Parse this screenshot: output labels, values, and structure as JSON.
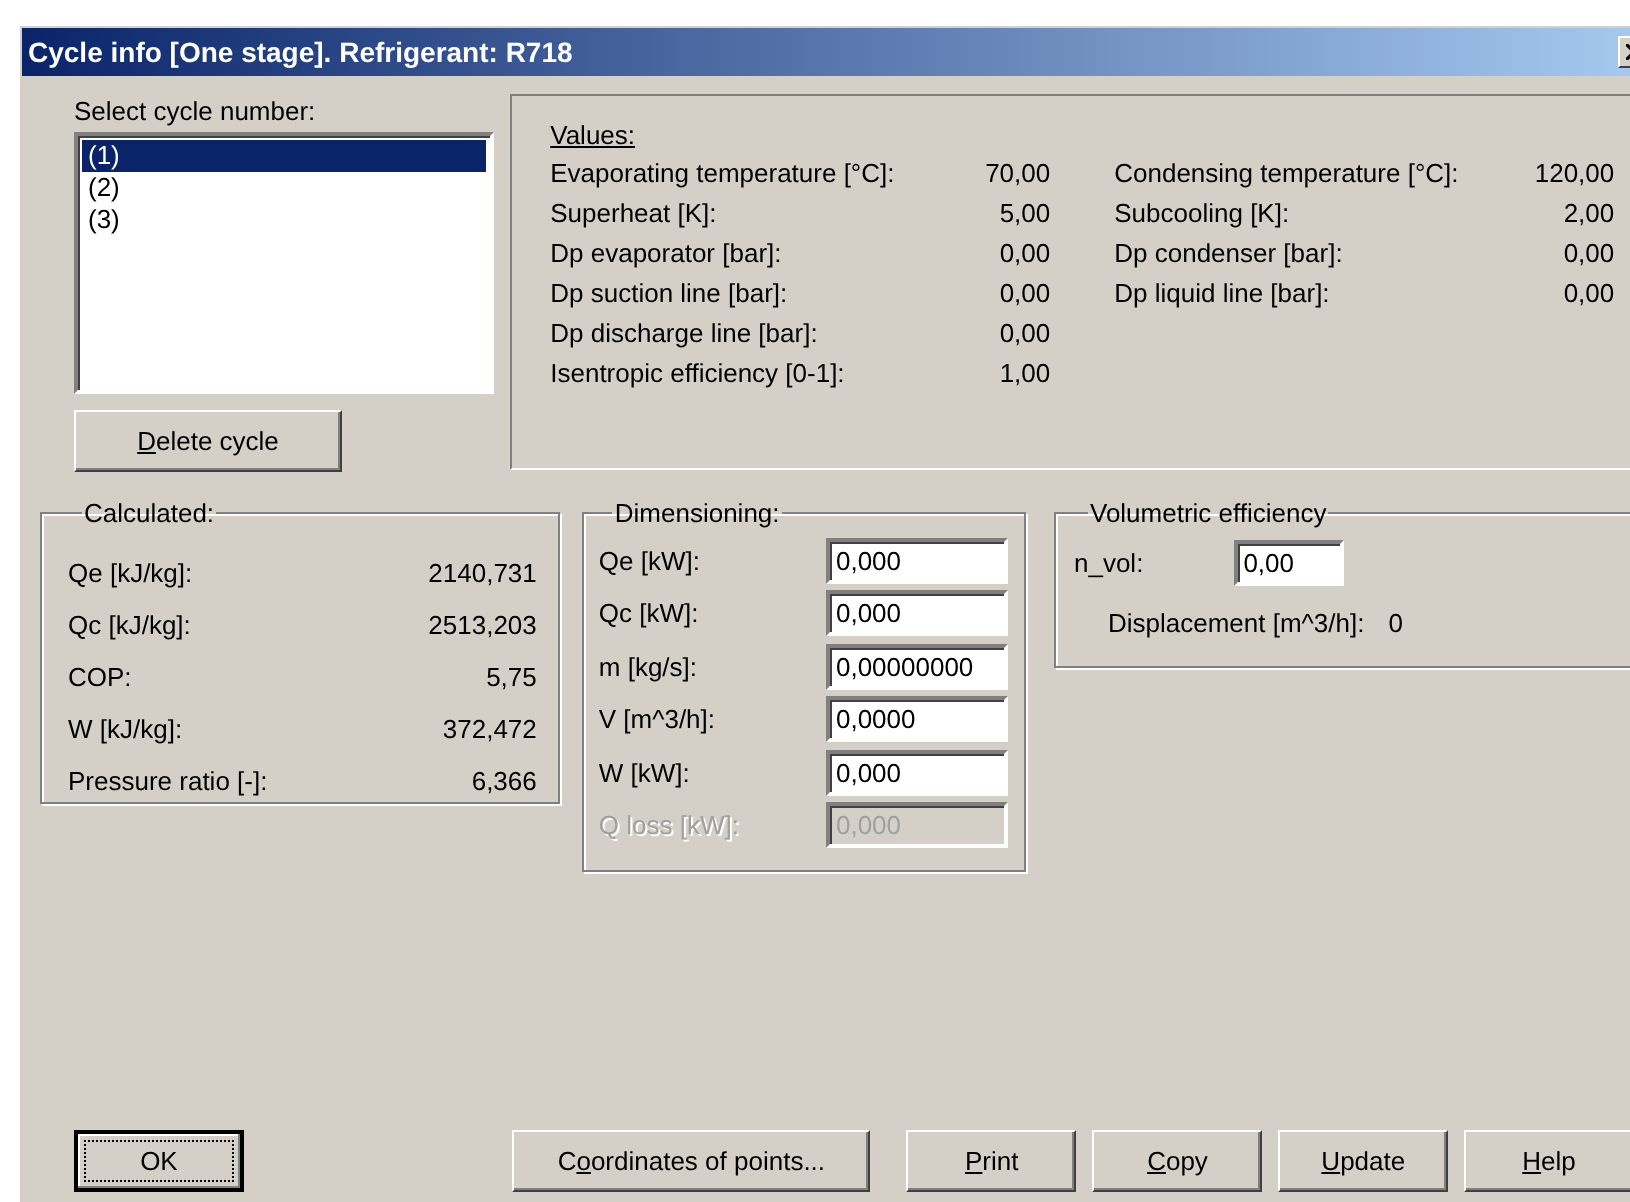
{
  "window": {
    "title": "Cycle info [One stage]. Refrigerant: R718"
  },
  "cycle_list": {
    "label": "Select cycle number:",
    "items": [
      {
        "label": "(1)",
        "selected": true
      },
      {
        "label": "(2)",
        "selected": false
      },
      {
        "label": "(3)",
        "selected": false
      }
    ]
  },
  "delete_button": {
    "parts": [
      {
        "text": "D",
        "underlined": true
      },
      {
        "text": "elete cycle",
        "underlined": false
      }
    ],
    "focused": false
  },
  "values": {
    "heading": "Values:",
    "left": [
      {
        "label": "Evaporating temperature [°C]:",
        "value": "70,00"
      },
      {
        "label": "Superheat [K]:",
        "value": "5,00"
      },
      {
        "label": "Dp evaporator [bar]:",
        "value": "0,00"
      },
      {
        "label": "Dp suction line [bar]:",
        "value": "0,00"
      },
      {
        "label": "Dp discharge line [bar]:",
        "value": "0,00"
      },
      {
        "label": "Isentropic efficiency [0-1]:",
        "value": "1,00"
      }
    ],
    "right": [
      {
        "label": "Condensing temperature [°C]:",
        "value": "120,00"
      },
      {
        "label": "Subcooling [K]:",
        "value": "2,00"
      },
      {
        "label": "Dp condenser [bar]:",
        "value": "0,00"
      },
      {
        "label": "Dp liquid line [bar]:",
        "value": "0,00"
      }
    ]
  },
  "calculated": {
    "title": "Calculated:",
    "rows": [
      {
        "label": "Qe [kJ/kg]:",
        "value": "2140,731"
      },
      {
        "label": "Qc [kJ/kg]:",
        "value": "2513,203"
      },
      {
        "label": "COP:",
        "value": "5,75"
      },
      {
        "label": "W [kJ/kg]:",
        "value": "372,472"
      },
      {
        "label": "Pressure ratio [-]:",
        "value": "6,366"
      }
    ]
  },
  "dimensioning": {
    "title": "Dimensioning:",
    "rows": [
      {
        "label": "Qe [kW]:",
        "value": "0,000",
        "disabled": false
      },
      {
        "label": "Qc [kW]:",
        "value": "0,000",
        "disabled": false
      },
      {
        "label": "m [kg/s]:",
        "value": "0,00000000",
        "disabled": false
      },
      {
        "label": "V [m^3/h]:",
        "value": "0,0000",
        "disabled": false
      },
      {
        "label": "W [kW]:",
        "value": "0,000",
        "disabled": false
      },
      {
        "label": "Q loss [kW]:",
        "value": "0,000",
        "disabled": true
      }
    ]
  },
  "volumetric": {
    "title": "Volumetric efficiency",
    "field": {
      "label": "n_vol:",
      "value": "0,00"
    },
    "displacement": {
      "label": "Displacement [m^3/h]:",
      "value": "0"
    }
  },
  "buttons": [
    {
      "parts": [
        {
          "text": "OK",
          "underlined": false
        }
      ],
      "focused": true
    },
    {
      "parts": [
        {
          "text": "C",
          "underlined": false
        },
        {
          "text": "o",
          "underlined": true
        },
        {
          "text": "ordinates of points...",
          "underlined": false
        }
      ],
      "focused": false
    },
    {
      "parts": [
        {
          "text": "P",
          "underlined": true
        },
        {
          "text": "rint",
          "underlined": false
        }
      ],
      "focused": false
    },
    {
      "parts": [
        {
          "text": "C",
          "underlined": true
        },
        {
          "text": "opy",
          "underlined": false
        }
      ],
      "focused": false
    },
    {
      "parts": [
        {
          "text": "U",
          "underlined": true
        },
        {
          "text": "pdate",
          "underlined": false
        }
      ],
      "focused": false
    },
    {
      "parts": [
        {
          "text": "H",
          "underlined": true
        },
        {
          "text": "elp",
          "underlined": false
        }
      ],
      "focused": false
    }
  ]
}
